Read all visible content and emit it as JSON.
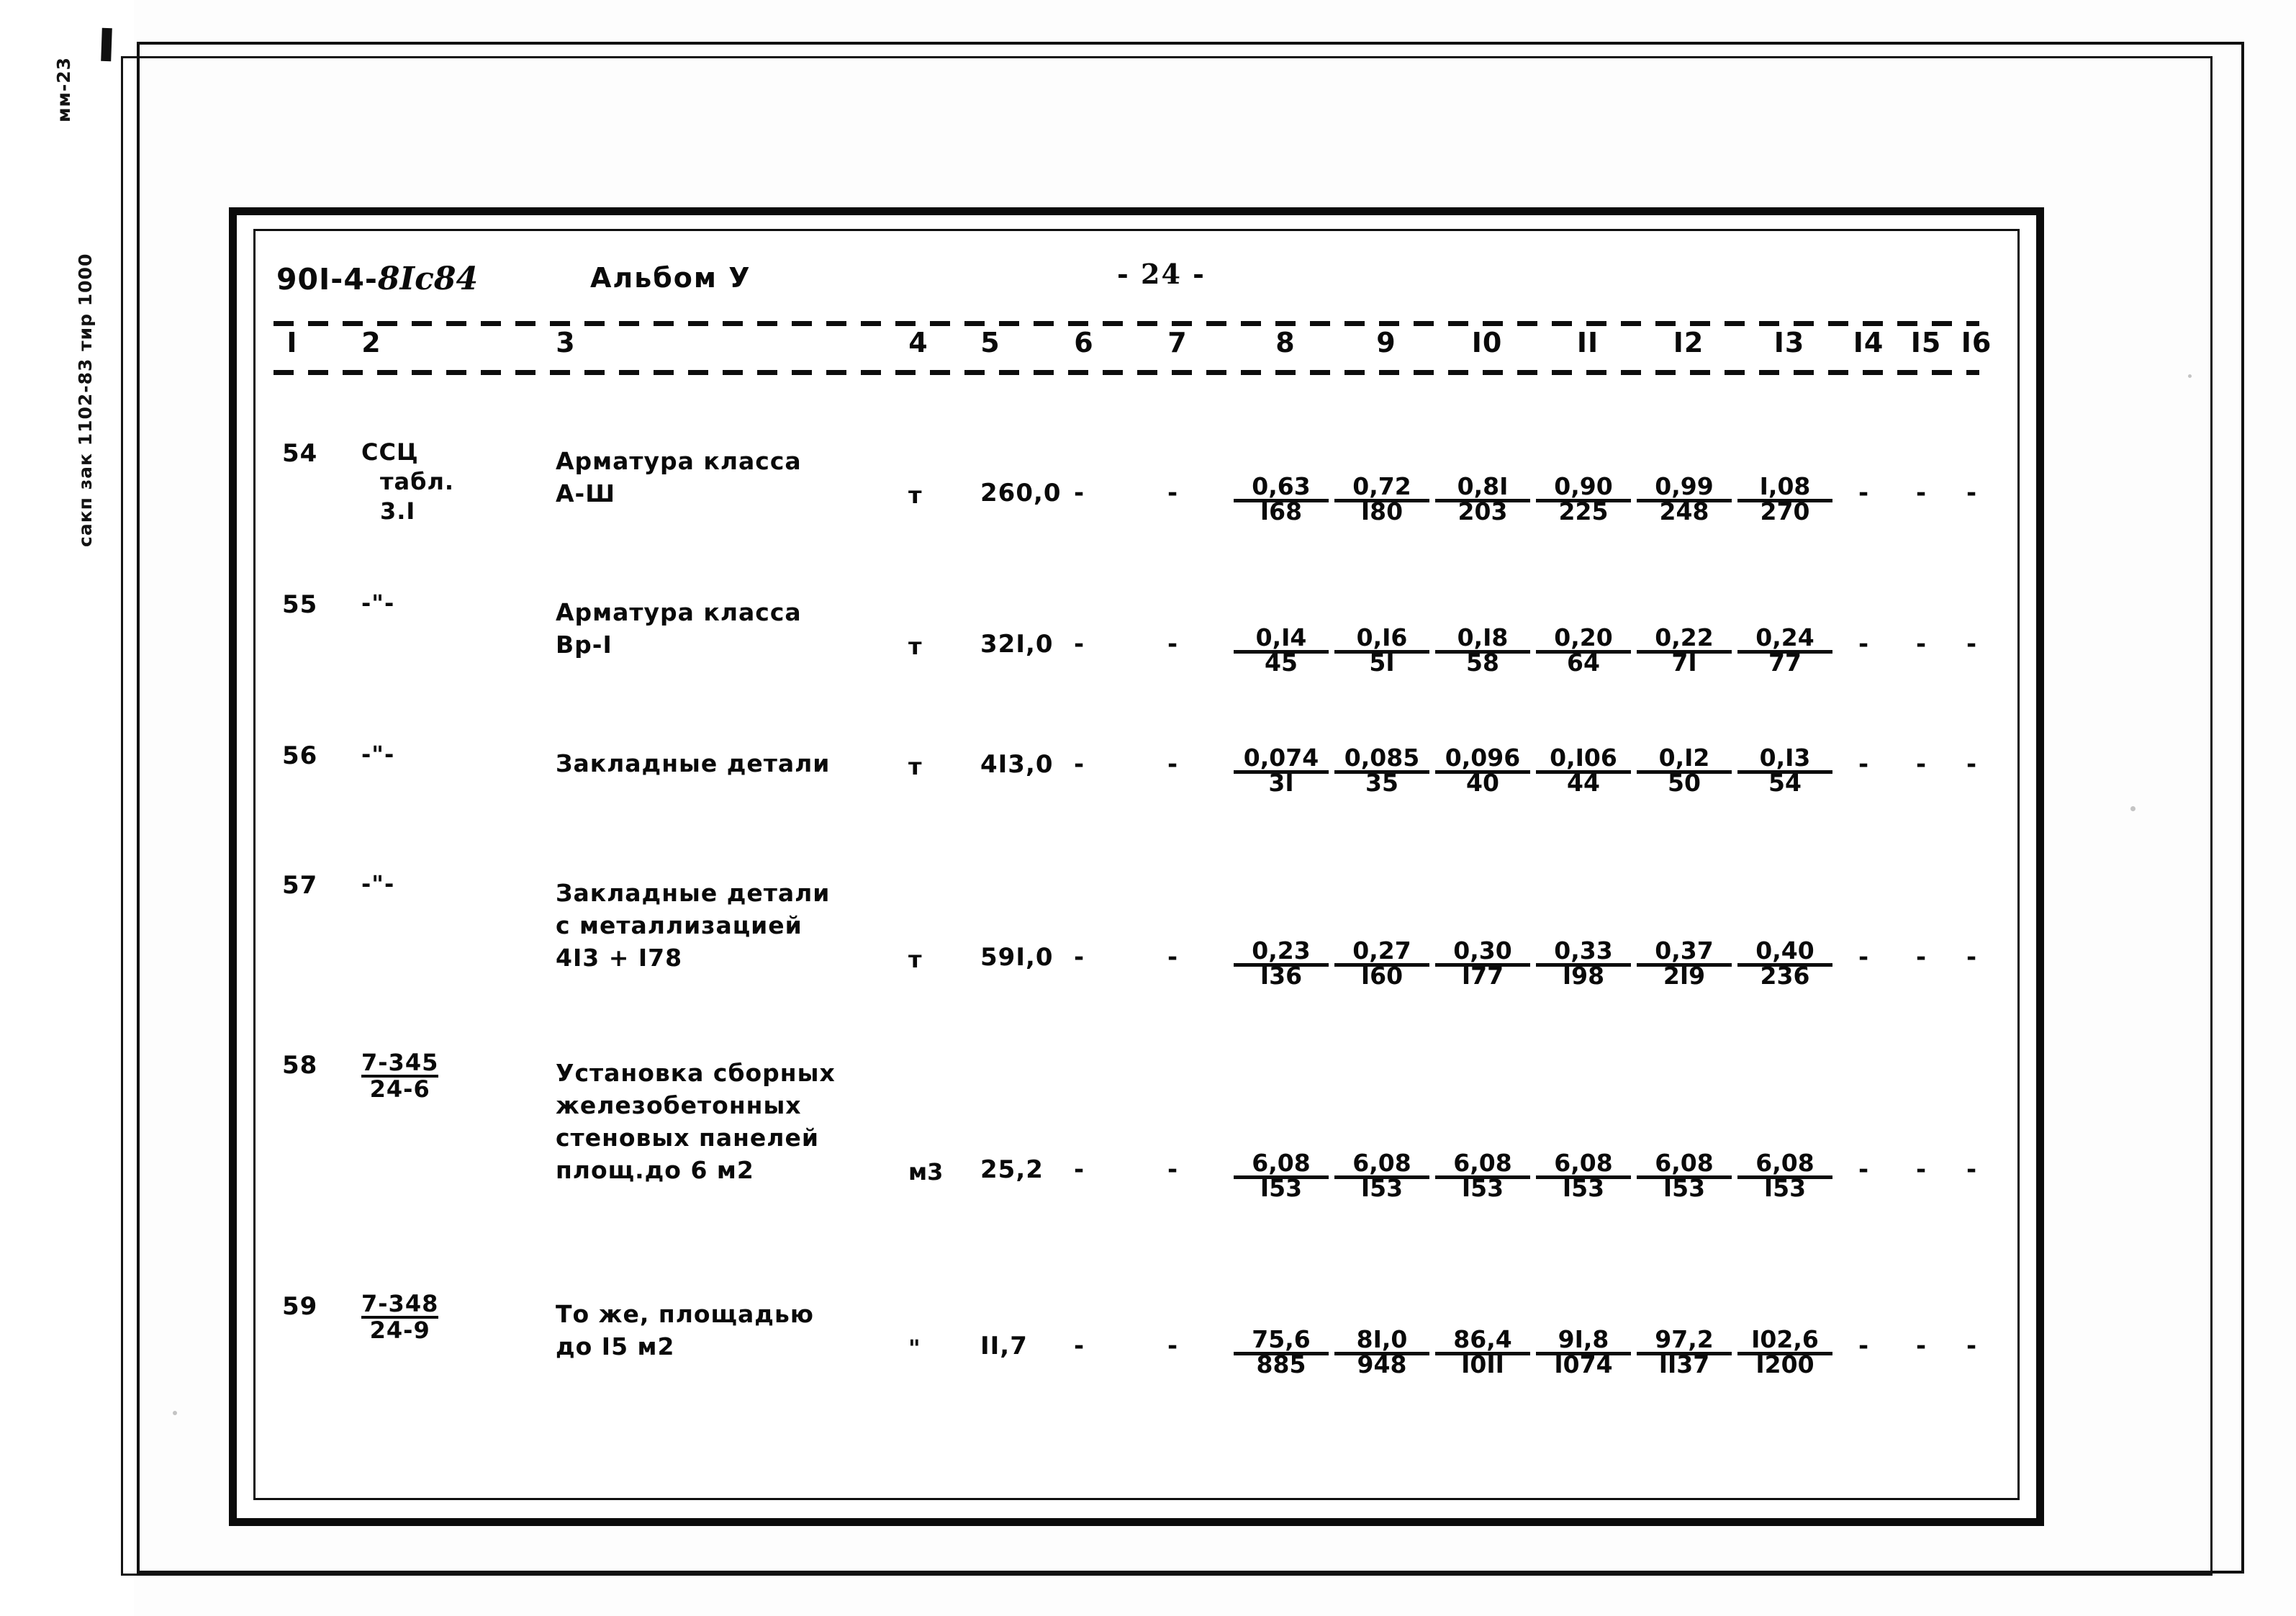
{
  "scan": {
    "margin_notes": [
      "сакп зак 1102-83  тир 1000",
      "мм-23"
    ]
  },
  "header": {
    "series_prefix": "90I-4-",
    "series_hand": "8Iс84",
    "album": "Альбом У",
    "page_label": "- 24 -"
  },
  "table": {
    "column_numbers": [
      "I",
      "2",
      "3",
      "4",
      "5",
      "6",
      "7",
      "8",
      "9",
      "I0",
      "II",
      "I2",
      "I3",
      "I4",
      "I5",
      "I6"
    ],
    "rows": [
      {
        "no": "54",
        "code": "ССЦ\nтабл.\n3.I",
        "code_lines": [
          "ССЦ",
          "табл.",
          "3.I"
        ],
        "name_lines": [
          "Арматура класса",
          "А-Ш"
        ],
        "unit": "т",
        "qty": "260,0",
        "col6": "-",
        "col7": "-",
        "values": [
          {
            "num": "0,63",
            "den": "I68"
          },
          {
            "num": "0,72",
            "den": "I80"
          },
          {
            "num": "0,8I",
            "den": "203"
          },
          {
            "num": "0,90",
            "den": "225"
          },
          {
            "num": "0,99",
            "den": "248"
          },
          {
            "num": "I,08",
            "den": "270"
          }
        ],
        "col14": "-",
        "col15": "-",
        "col16": "-"
      },
      {
        "no": "55",
        "code_lines": [
          "-\"-"
        ],
        "name_lines": [
          "Арматура класса",
          "Вр-I"
        ],
        "unit": "т",
        "qty": "32I,0",
        "col6": "-",
        "col7": "-",
        "values": [
          {
            "num": "0,I4",
            "den": "45"
          },
          {
            "num": "0,I6",
            "den": "5I"
          },
          {
            "num": "0,I8",
            "den": "58"
          },
          {
            "num": "0,20",
            "den": "64"
          },
          {
            "num": "0,22",
            "den": "7I"
          },
          {
            "num": "0,24",
            "den": "77"
          }
        ],
        "col14": "-",
        "col15": "-",
        "col16": "-"
      },
      {
        "no": "56",
        "code_lines": [
          "-\"-"
        ],
        "name_lines": [
          "Закладные детали"
        ],
        "unit": "т",
        "qty": "4I3,0",
        "col6": "-",
        "col7": "-",
        "values": [
          {
            "num": "0,074",
            "den": "3I"
          },
          {
            "num": "0,085",
            "den": "35"
          },
          {
            "num": "0,096",
            "den": "40"
          },
          {
            "num": "0,I06",
            "den": "44"
          },
          {
            "num": "0,I2",
            "den": "50"
          },
          {
            "num": "0,I3",
            "den": "54"
          }
        ],
        "col14": "-",
        "col15": "-",
        "col16": "-"
      },
      {
        "no": "57",
        "code_lines": [
          "-\"-"
        ],
        "name_lines": [
          "Закладные детали",
          "с металлизацией",
          "4I3 + I78"
        ],
        "unit": "т",
        "qty": "59I,0",
        "col6": "-",
        "col7": "-",
        "values": [
          {
            "num": "0,23",
            "den": "I36"
          },
          {
            "num": "0,27",
            "den": "I60"
          },
          {
            "num": "0,30",
            "den": "I77"
          },
          {
            "num": "0,33",
            "den": "I98"
          },
          {
            "num": "0,37",
            "den": "2I9"
          },
          {
            "num": "0,40",
            "den": "236"
          }
        ],
        "col14": "-",
        "col15": "-",
        "col16": "-"
      },
      {
        "no": "58",
        "code_frac": {
          "num": "7-345",
          "den": "24-6"
        },
        "name_lines": [
          "Установка сборных",
          "железобетонных",
          "стеновых панелей",
          "площ.до 6 м2"
        ],
        "unit": "м3",
        "qty": "25,2",
        "col6": "-",
        "col7": "-",
        "values": [
          {
            "num": "6,08",
            "den": "I53"
          },
          {
            "num": "6,08",
            "den": "I53"
          },
          {
            "num": "6,08",
            "den": "I53"
          },
          {
            "num": "6,08",
            "den": "I53"
          },
          {
            "num": "6,08",
            "den": "I53"
          },
          {
            "num": "6,08",
            "den": "I53"
          }
        ],
        "col14": "-",
        "col15": "-",
        "col16": "-"
      },
      {
        "no": "59",
        "code_frac": {
          "num": "7-348",
          "den": "24-9"
        },
        "name_lines": [
          "То же, площадью",
          "до I5 м2"
        ],
        "unit": "\"",
        "qty": "II,7",
        "col6": "-",
        "col7": "-",
        "values": [
          {
            "num": "75,6",
            "den": "885"
          },
          {
            "num": "8I,0",
            "den": "948"
          },
          {
            "num": "86,4",
            "den": "I0II"
          },
          {
            "num": "9I,8",
            "den": "I074"
          },
          {
            "num": "97,2",
            "den": "II37"
          },
          {
            "num": "I02,6",
            "den": "I200"
          }
        ],
        "col14": "-",
        "col15": "-",
        "col16": "-"
      }
    ]
  },
  "layout": {
    "col_x": [
      40,
      150,
      420,
      910,
      1010,
      1140,
      1270,
      1420,
      1560,
      1700,
      1840,
      1980,
      2120,
      2230,
      2310,
      2380
    ],
    "row_tops": [
      80,
      290,
      500,
      680,
      930,
      1265
    ],
    "value_x": [
      1428,
      1568,
      1708,
      1848,
      1988,
      2128
    ]
  },
  "colors": {
    "ink": "#0a0a0a",
    "paper": "#ffffff"
  }
}
